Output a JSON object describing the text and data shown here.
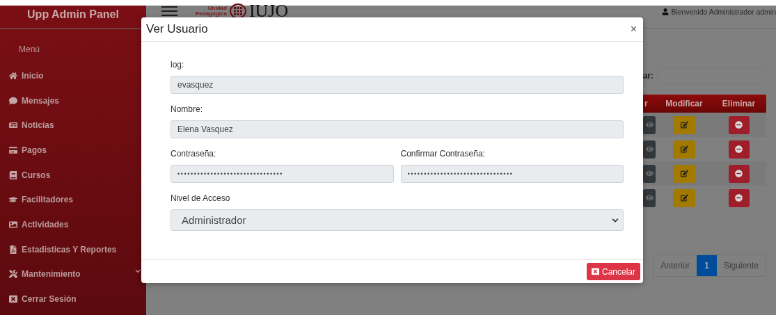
{
  "sidebar": {
    "title": "Upp Admin Panel",
    "menu_label": "Menú",
    "items": [
      {
        "label": "Inicio",
        "kind": "link"
      },
      {
        "label": "Mensajes",
        "kind": "link"
      },
      {
        "label": "Noticias",
        "kind": "link"
      },
      {
        "label": "Pagos",
        "kind": "link"
      },
      {
        "label": "Cursos",
        "kind": "link"
      },
      {
        "label": "Facilitadores",
        "kind": "link"
      },
      {
        "label": "Actividades",
        "kind": "link"
      },
      {
        "label": "Estadisticas Y Reportes",
        "kind": "link"
      },
      {
        "label": "Mantenimiento",
        "kind": "submenu"
      },
      {
        "label": "Cerrar Sesión",
        "kind": "link"
      }
    ]
  },
  "topbar": {
    "logo_lines": [
      "Unidad",
      "Pedagógica"
    ],
    "logo_text": "IUJO",
    "welcome": "Bienvenido Administrador admin"
  },
  "search": {
    "label": "ar:"
  },
  "table": {
    "columns": [
      "r",
      "Modificar",
      "Eliminar"
    ],
    "rows": [
      {
        "actions": [
          {
            "kind": "view"
          },
          {
            "kind": "edit"
          },
          {
            "kind": "delete"
          }
        ]
      },
      {
        "actions": [
          {
            "kind": "view"
          },
          {
            "kind": "edit"
          },
          {
            "kind": "delete"
          }
        ]
      },
      {
        "actions": [
          {
            "kind": "view"
          },
          {
            "kind": "edit"
          },
          {
            "kind": "delete"
          }
        ]
      },
      {
        "actions": [
          {
            "kind": "view"
          },
          {
            "kind": "edit"
          },
          {
            "kind": "delete"
          }
        ]
      }
    ]
  },
  "pagination": {
    "previous": "Anterior",
    "pages": [
      {
        "label": "1",
        "selected": true
      }
    ],
    "next": "Siguiente"
  },
  "modal": {
    "title": "Ver Usuario",
    "close": "×",
    "fields": [
      {
        "label": "log:",
        "value": "evasquez",
        "kind": "text"
      },
      {
        "label": "Nombre:",
        "value": "Elena Vasquez",
        "kind": "text"
      },
      {
        "label": "Contraseña:",
        "value": "••••••••••••••••••••••••••••••••",
        "kind": "password"
      },
      {
        "label": "Confirmar Contraseña:",
        "value": "••••••••••••••••••••••••••••••••",
        "kind": "password"
      },
      {
        "label": "Nivel de Acceso",
        "value": "Administrador",
        "kind": "select"
      }
    ],
    "buttons": [
      {
        "label": "Cancelar"
      }
    ]
  }
}
